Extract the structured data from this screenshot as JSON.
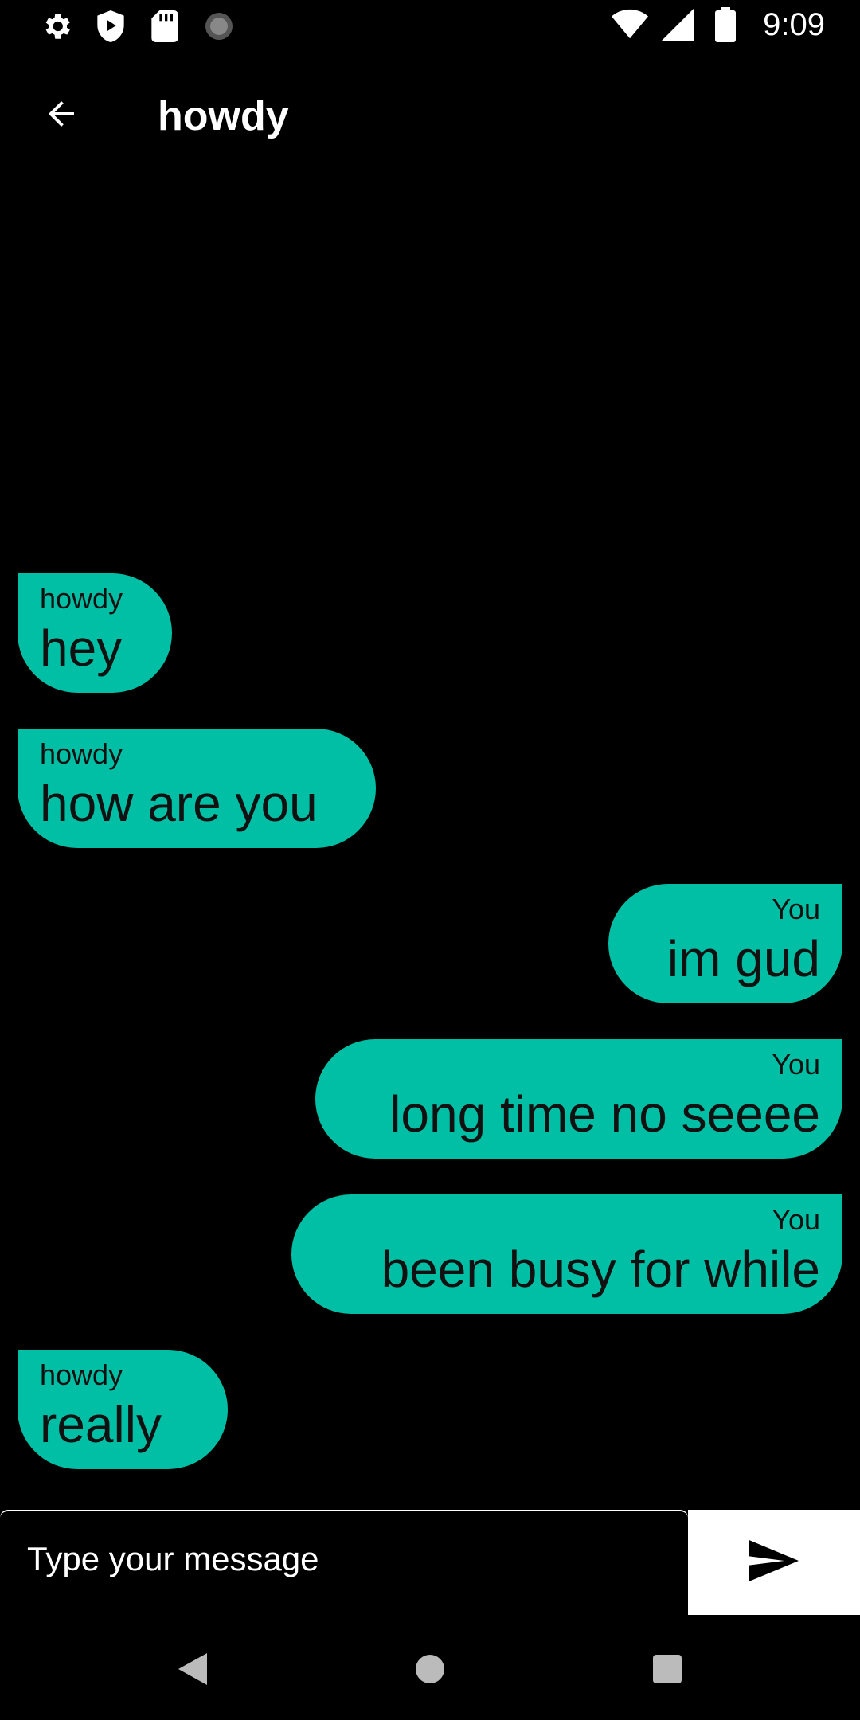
{
  "status_bar": {
    "time": "9:09",
    "left_icons": [
      "gear-icon",
      "shield-play-icon",
      "sd-card-icon",
      "loading-icon"
    ],
    "right_icons": [
      "wifi-icon",
      "cell-signal-icon",
      "battery-icon"
    ]
  },
  "app_bar": {
    "title": "howdy",
    "back_icon": "arrow-left-icon"
  },
  "messages": [
    {
      "sender": "howdy",
      "text": "hey",
      "side": "left"
    },
    {
      "sender": "howdy",
      "text": "how are you",
      "side": "left"
    },
    {
      "sender": "You",
      "text": "im gud",
      "side": "right"
    },
    {
      "sender": "You",
      "text": "long time no seeee",
      "side": "right"
    },
    {
      "sender": "You",
      "text": "been busy for while",
      "side": "right"
    },
    {
      "sender": "howdy",
      "text": "really",
      "side": "left"
    }
  ],
  "composer": {
    "placeholder": "Type your message",
    "send_icon": "send-icon"
  },
  "nav_bar": {
    "icons": [
      "back-triangle-icon",
      "home-circle-icon",
      "recents-square-icon"
    ]
  },
  "colors": {
    "background": "#000000",
    "bubble": "#00BFA5",
    "text_on_bubble": "#111111"
  }
}
